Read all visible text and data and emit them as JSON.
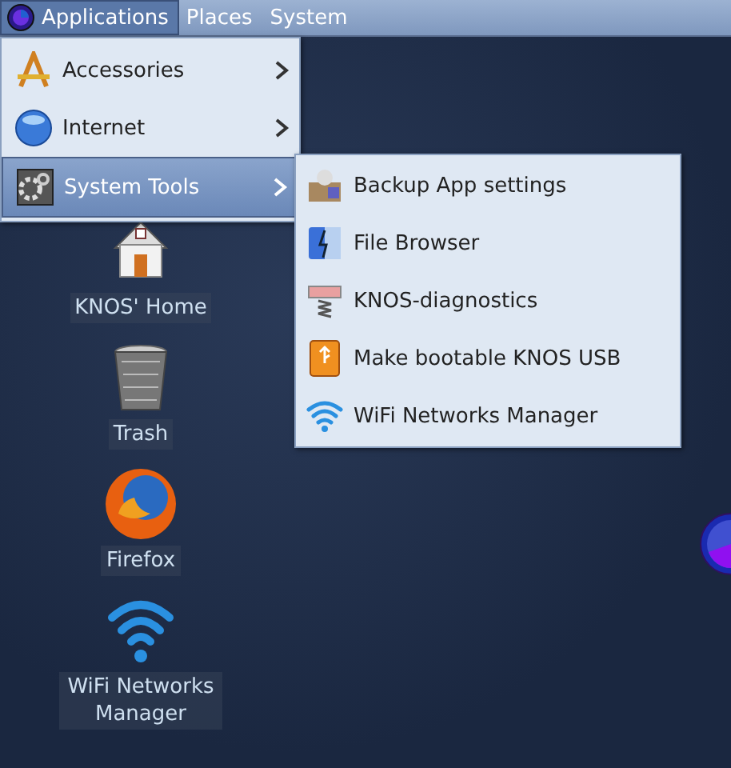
{
  "panel": {
    "menus": [
      {
        "label": "Applications",
        "selected": true,
        "kind": "logo"
      },
      {
        "label": "Places",
        "selected": false
      },
      {
        "label": "System",
        "selected": false
      }
    ]
  },
  "menu": {
    "items": [
      {
        "label": "Accessories",
        "kind": "accessories",
        "selected": false,
        "submenu": true
      },
      {
        "label": "Internet",
        "kind": "globe",
        "selected": false,
        "submenu": true
      },
      {
        "label": "System Tools",
        "kind": "gears",
        "selected": true,
        "submenu": true
      }
    ]
  },
  "submenu": {
    "items": [
      {
        "label": "Backup App settings",
        "kind": "box"
      },
      {
        "label": "File Browser",
        "kind": "finder"
      },
      {
        "label": "KNOS-diagnostics",
        "kind": "diag"
      },
      {
        "label": "Make bootable KNOS USB",
        "kind": "usb"
      },
      {
        "label": "WiFi Networks Manager",
        "kind": "wifi"
      }
    ]
  },
  "desktop": {
    "icons": [
      {
        "label": "KNOS' Home",
        "kind": "home"
      },
      {
        "label": "Trash",
        "kind": "trash"
      },
      {
        "label": "Firefox",
        "kind": "browser"
      },
      {
        "label": "WiFi Networks Manager",
        "kind": "wifi"
      }
    ]
  }
}
